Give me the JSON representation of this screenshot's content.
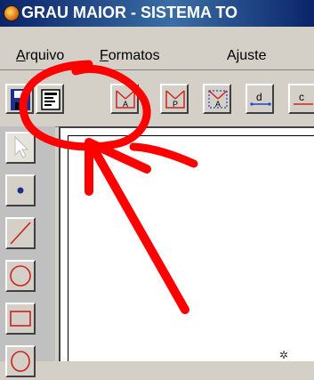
{
  "window": {
    "title": "GRAU MAIOR - SISTEMA TO",
    "icon": "app-globe-icon"
  },
  "menu": {
    "items": [
      {
        "label": "Arquivo",
        "mnemonic": "A"
      },
      {
        "label": "Formatos",
        "mnemonic": "F"
      },
      {
        "label": "Ajuste",
        "mnemonic": "j"
      }
    ]
  },
  "toolbar": {
    "buttons": [
      {
        "icon": "save-icon"
      },
      {
        "icon": "format-icon"
      },
      {
        "icon": "shape-a-icon",
        "label": "A"
      },
      {
        "icon": "shape-p-icon",
        "label": "P"
      },
      {
        "icon": "shape-dotted-a-icon",
        "label": "A"
      },
      {
        "icon": "dimension-d-icon",
        "label": "d"
      },
      {
        "icon": "dimension-c-icon",
        "label": "c"
      }
    ]
  },
  "tools": {
    "items": [
      {
        "icon": "pointer-icon"
      },
      {
        "icon": "point-icon"
      },
      {
        "icon": "line-icon"
      },
      {
        "icon": "circle-icon"
      },
      {
        "icon": "rectangle-icon"
      },
      {
        "icon": "ellipse-icon"
      }
    ]
  },
  "colors": {
    "annotation": "#ff0000",
    "titlebar": "#0a246a",
    "toolbar_glyph": "#cc2222"
  }
}
